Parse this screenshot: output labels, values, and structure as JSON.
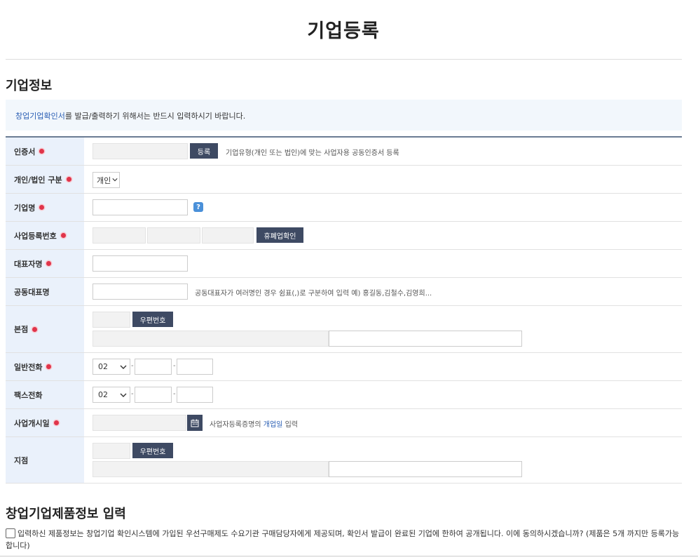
{
  "page": {
    "title": "기업등록"
  },
  "section1": {
    "title": "기업정보"
  },
  "notice": {
    "link_text": "창업기업확인서",
    "rest": "를 발급/출력하기 위해서는 반드시 입력하시기 바랍니다."
  },
  "rows": {
    "cert": {
      "label": "인증서",
      "button": "등록",
      "hint": "기업유형(개인 또는 법인)에 맞는 사업자용 공동인증서 등록"
    },
    "type": {
      "label": "개인/법인 구분",
      "selected": "개인"
    },
    "company": {
      "label": "기업명",
      "help": "?"
    },
    "bizno": {
      "label": "사업등록번호",
      "button": "휴폐업확인"
    },
    "ceo": {
      "label": "대표자명"
    },
    "coceo": {
      "label": "공동대표명",
      "hint": "공동대표자가 여러명인 경우 쉼표(,)로 구분하여 입력   예) 홍길동,김철수,김영희..."
    },
    "hq": {
      "label": "본점",
      "button": "우편번호"
    },
    "phone": {
      "label": "일반전화",
      "area": "02",
      "sep": "-"
    },
    "fax": {
      "label": "팩스전화",
      "area": "02",
      "sep": "-"
    },
    "opendate": {
      "label": "사업개시일",
      "hint_pre": "사업자등록증명의 ",
      "hint_link": "개업일",
      "hint_post": " 입력"
    },
    "branch": {
      "label": "지점",
      "button": "우편번호"
    }
  },
  "section2": {
    "title": "창업기업제품정보 입력"
  },
  "agree": {
    "text": "입력하신 제품정보는 창업기업 확인시스템에 가입된 우선구매제도 수요기관 구매담당자에게 제공되며, 확인서 발급이 완료된 기업에 한하여 공개됩니다. 이에 동의하시겠습니까? (제품은 5개 까지만 등록가능합니다)"
  },
  "colors": {
    "accent": "#3e4a63",
    "label_bg": "#eaf1fb",
    "required": "#e0344a",
    "link": "#2b5fb4"
  }
}
